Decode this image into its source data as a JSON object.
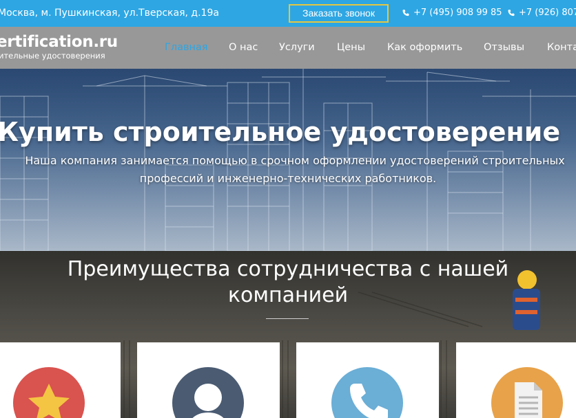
{
  "topbar": {
    "address": "Москва, м. Пушкинская, ул.Тверская, д.19а",
    "callback_label": "Заказать звонок",
    "phone1": "+7 (495) 908 99 85",
    "phone2": "+7 (926) 807 1"
  },
  "logo": {
    "name": "ertification.ru",
    "tagline": "ительные удостоверения"
  },
  "nav": {
    "items": [
      {
        "label": "Главная"
      },
      {
        "label": "О нас"
      },
      {
        "label": "Услуги"
      },
      {
        "label": "Цены"
      },
      {
        "label": "Как оформить"
      },
      {
        "label": "Отзывы"
      },
      {
        "label": "Конта"
      }
    ]
  },
  "hero": {
    "title": "Купить строительное удостоверение",
    "text_line1": "Наша компания занимается помощью в срочном оформлении удостоверений строительных",
    "text_line2": "профессий и инженерно-технических работников."
  },
  "advantages": {
    "title_line1": "Преимущества сотрудничества с нашей",
    "title_line2": "компанией",
    "cards": [
      {
        "icon": "star-icon",
        "color": "#d9534f"
      },
      {
        "icon": "user-icon",
        "color": "#4a5b72"
      },
      {
        "icon": "phone-icon",
        "color": "#6baed6"
      },
      {
        "icon": "document-icon",
        "color": "#e8a24a"
      }
    ]
  },
  "colors": {
    "accent": "#2ea6e3",
    "callback_border": "#e6c73f",
    "nav_bg": "#989898"
  }
}
